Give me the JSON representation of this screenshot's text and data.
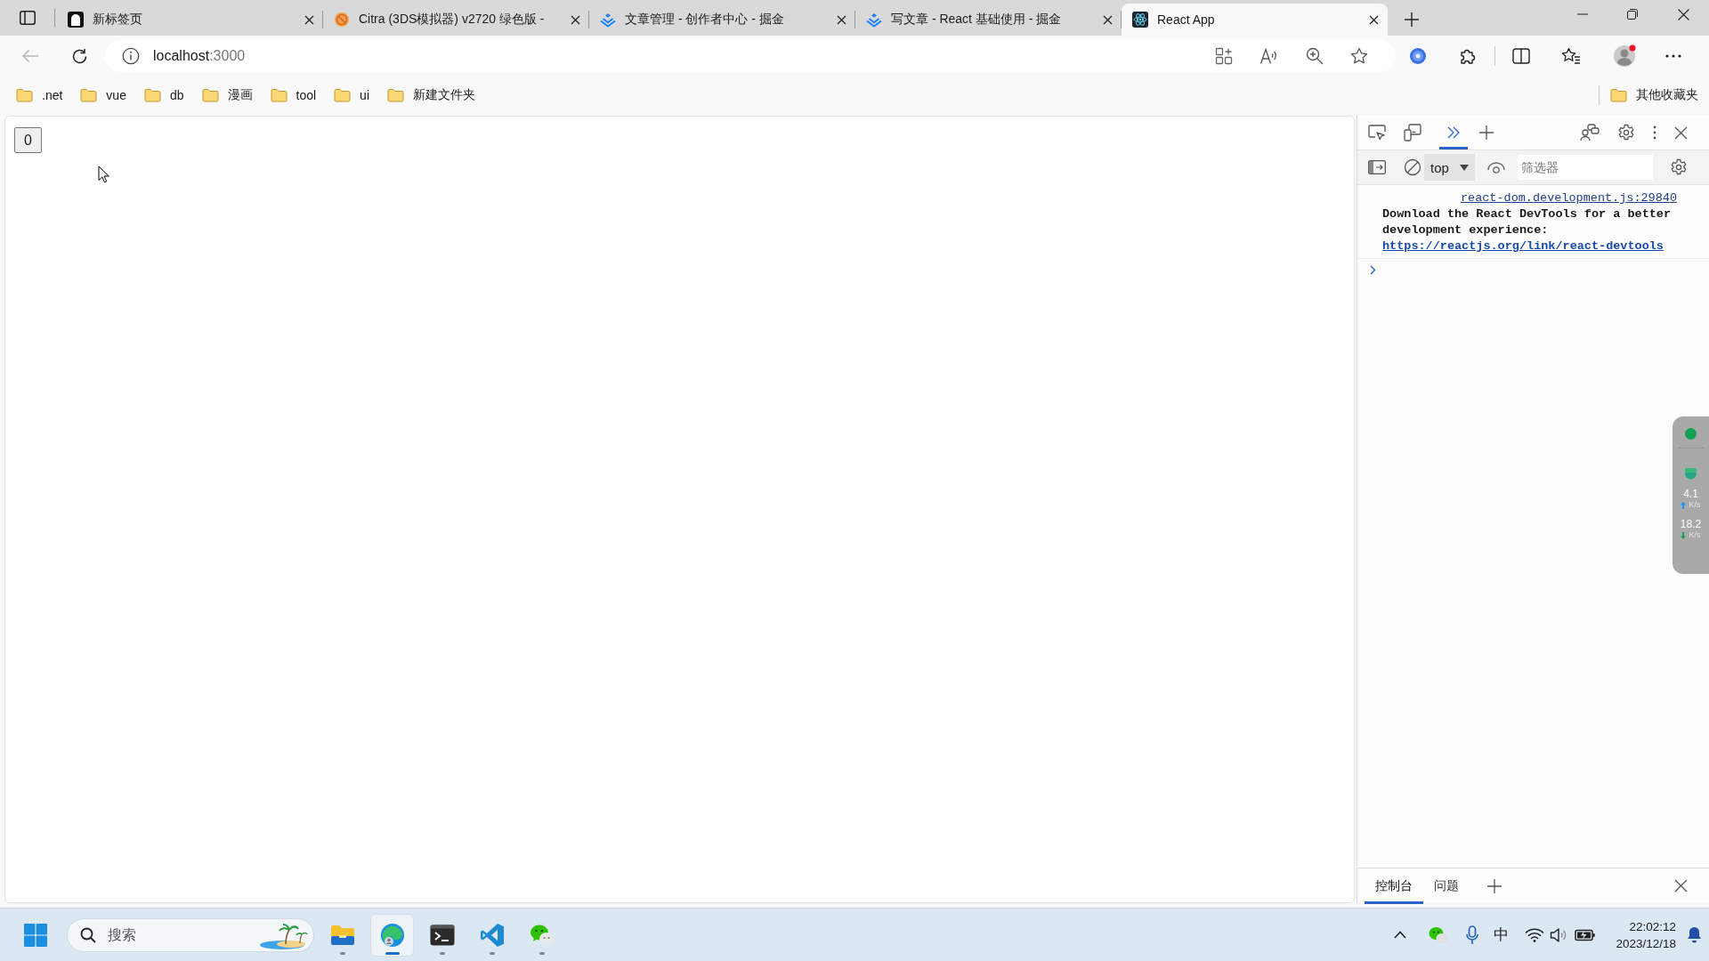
{
  "browser": {
    "tabs": [
      {
        "title": "新标签页",
        "selected": false
      },
      {
        "title": "Citra (3DS模拟器) v2720 绿色版 -",
        "selected": false
      },
      {
        "title": "文章管理 - 创作者中心 - 掘金",
        "selected": false
      },
      {
        "title": "写文章 - React 基础使用 - 掘金",
        "selected": false
      },
      {
        "title": "React App",
        "selected": true
      }
    ],
    "address": {
      "host": "localhost",
      "port": ":3000"
    },
    "bookmarks": [
      ".net",
      "vue",
      "db",
      "漫画",
      "tool",
      "ui",
      "新建文件夹"
    ],
    "other_bookmarks": "其他收藏夹"
  },
  "page": {
    "counter_button": "0"
  },
  "devtools": {
    "overflow_tab": {
      "selected": true
    },
    "context": "top",
    "filter": {
      "placeholder": "筛选器"
    },
    "console": [
      {
        "source": "react-dom.development.js:29840",
        "text": "Download the React DevTools for a better development experience:",
        "link": "https://reactjs.org/link/react-devtools"
      }
    ],
    "drawer_tabs": [
      {
        "label": "控制台",
        "selected": true
      },
      {
        "label": "问题",
        "selected": false
      }
    ]
  },
  "speed_widget": {
    "upload": "4.1",
    "upload_unit": "K/s",
    "download": "18.2",
    "download_unit": "K/s"
  },
  "taskbar": {
    "search": {
      "placeholder": "搜索"
    },
    "apps": [
      {
        "selected": false
      },
      {
        "selected": true
      },
      {
        "selected": false
      },
      {
        "selected": false
      },
      {
        "selected": false
      }
    ],
    "ime": "中",
    "time": "22:02:12",
    "date": "2023/12/18"
  }
}
